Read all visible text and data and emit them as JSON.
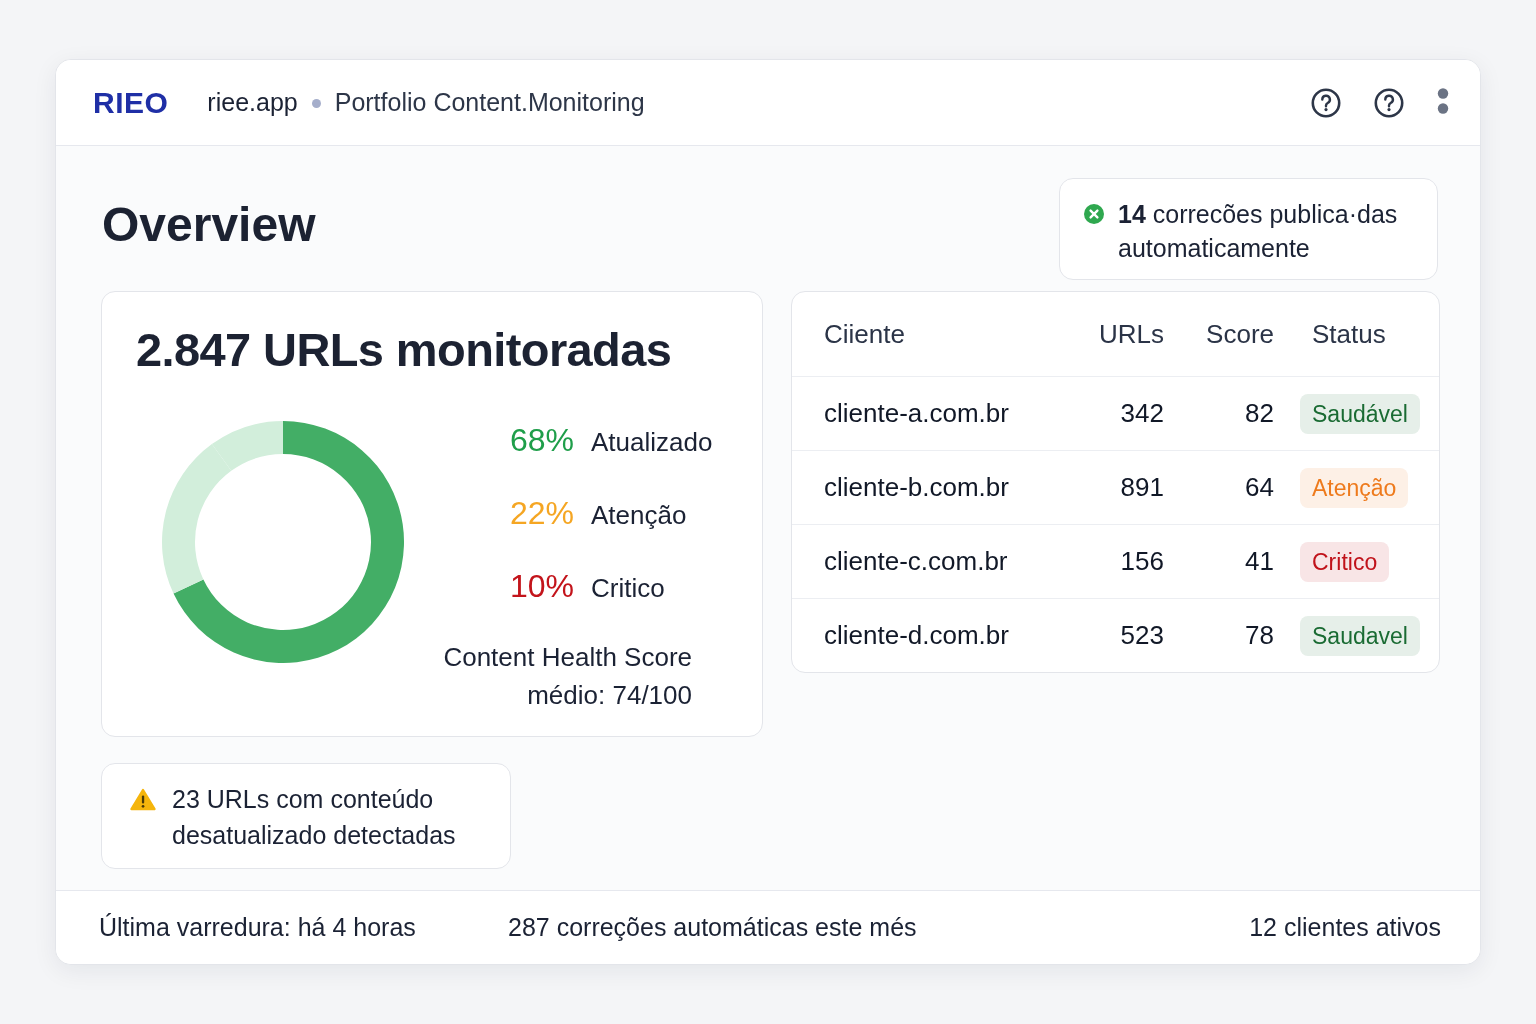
{
  "header": {
    "logo": "RIEO",
    "domain": "riee.app",
    "title": "Portfolio Content.Monitoring"
  },
  "page_title": "Overview",
  "notice": {
    "text": "**14** correcões publica·das automaticamente"
  },
  "summary_card": {
    "title": "2.847 URLs monitoradas",
    "chart_data": {
      "type": "donut",
      "categories": [
        "Atualizado",
        "Atenção",
        "Critico"
      ],
      "values": [
        68,
        22,
        10
      ]
    },
    "legend": [
      {
        "value": "68%",
        "color": "#1f9e4a"
      },
      {
        "value": "22%",
        "color": "#f5a623"
      },
      {
        "value": "10%",
        "color": "#c3141b"
      }
    ],
    "score": "Content Health Score médio: 74/100"
  },
  "clients_table": {
    "columns": [
      "Ciiente",
      "URLs",
      "Score",
      "Status"
    ],
    "rows": [
      {
        "client": "cliente-a.com.br",
        "urls": "342",
        "score": "82",
        "status": "Saudável",
        "color": "#1a6b33"
      },
      {
        "client": "cliente-b.com.br",
        "urls": "891",
        "score": "64",
        "status": "Atenção",
        "color": "#ee7a1c"
      },
      {
        "client": "cliente-c.com.br",
        "urls": "156",
        "score": "41",
        "status": "Critico",
        "color": "#c0121a"
      },
      {
        "client": "cliente-d.com.br",
        "urls": "523",
        "score": "78",
        "status": "Saudavel",
        "color": "#1a6b33"
      }
    ]
  },
  "alert": {
    "text": "23 URLs com conteúdo desatualizado detectadas"
  },
  "status_bar": [
    "Última varredura: há 4 horas",
    "287 correções automáticas este més",
    "12 clientes ativos"
  ]
}
